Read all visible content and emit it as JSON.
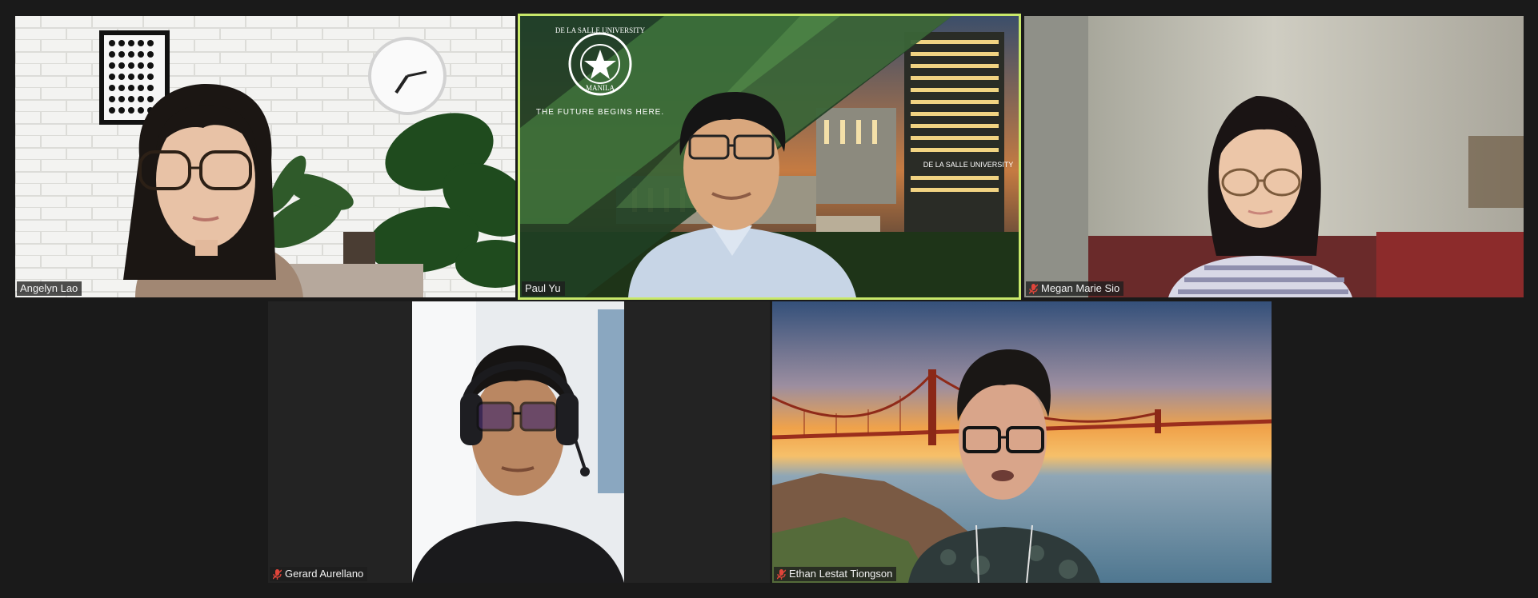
{
  "meeting": {
    "participants": [
      {
        "id": "angelyn",
        "name": "Angelyn Lao",
        "muted": false,
        "active_speaker": false,
        "video_background": "living room with clock and plant"
      },
      {
        "id": "paul",
        "name": "Paul Yu",
        "muted": false,
        "active_speaker": true,
        "video_background": "De La Salle University virtual background"
      },
      {
        "id": "megan",
        "name": "Megan Marie Sio",
        "muted": true,
        "active_speaker": false,
        "video_background": "blurred room"
      },
      {
        "id": "gerard",
        "name": "Gerard Aurellano",
        "muted": true,
        "active_speaker": false,
        "video_background": "room with headphones"
      },
      {
        "id": "ethan",
        "name": "Ethan Lestat Tiongson",
        "muted": true,
        "active_speaker": false,
        "video_background": "Golden Gate Bridge at sunset"
      }
    ]
  },
  "background_text": {
    "dlsu_tagline": "THE FUTURE BEGINS HERE.",
    "dlsu_seal_top": "DE LA SALLE UNIVERSITY",
    "dlsu_seal_bottom": "MANILA",
    "dlsu_building_sign": "DE LA SALLE UNIVERSITY"
  },
  "colors": {
    "active_border": "#c8e86a",
    "muted_mic": "#e0453a",
    "window_bg": "#1a1a1a"
  }
}
